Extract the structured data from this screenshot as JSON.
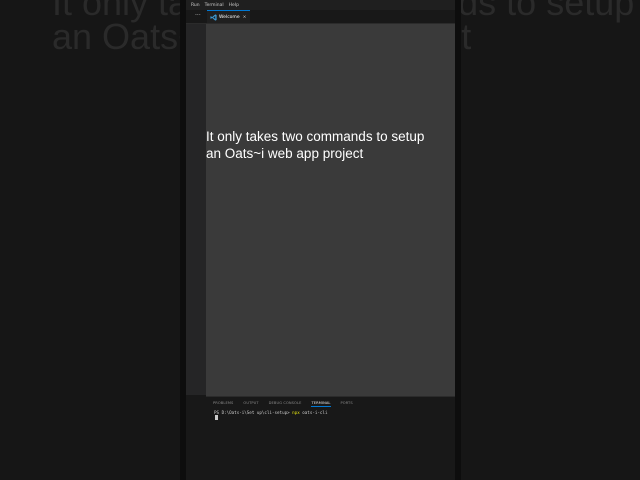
{
  "background": {
    "line1": "It only takes two commands to setup",
    "line2": "an Oats~i web app project"
  },
  "menubar": {
    "items": [
      "Run",
      "Terminal",
      "Help"
    ]
  },
  "editor": {
    "more_actions": "···",
    "tab": {
      "label": "Welcome",
      "close": "×"
    }
  },
  "caption": {
    "line1": "It only takes two commands to setup",
    "line2": "an Oats~i web app project"
  },
  "panel": {
    "tabs": [
      "PROBLEMS",
      "OUTPUT",
      "DEBUG CONSOLE",
      "TERMINAL",
      "PORTS"
    ],
    "active_tab": "TERMINAL",
    "terminal": {
      "prompt": "PS D:\\Oats-i\\Set up\\cli-setup> ",
      "command": "npx",
      "args": " oats-i-cli"
    }
  },
  "colors": {
    "accent": "#0078d4",
    "editor_bg": "#3a3a3a",
    "chrome_bg": "#1f1f1f",
    "command": "#e5e510"
  }
}
